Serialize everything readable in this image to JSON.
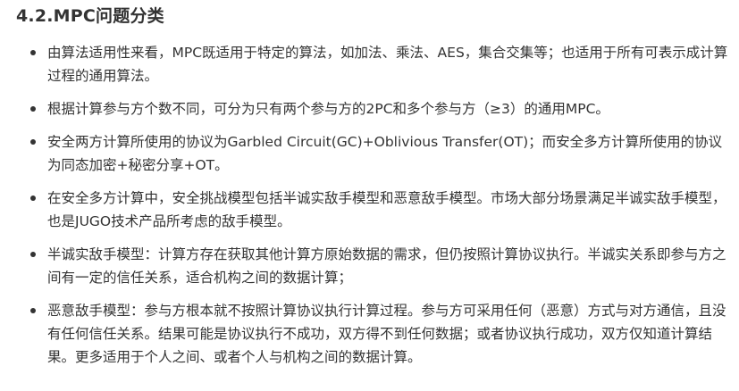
{
  "heading": "4.2.MPC问题分类",
  "items": [
    "由算法适用性来看，MPC既适用于特定的算法，如加法、乘法、AES，集合交集等；也适用于所有可表示成计算过程的通用算法。",
    "根据计算参与方个数不同，可分为只有两个参与方的2PC和多个参与方（≥3）的通用MPC。",
    "安全两方计算所使用的协议为Garbled Circuit(GC)+Oblivious Transfer(OT)；而安全多方计算所使用的协议为同态加密+秘密分享+OT。",
    "在安全多方计算中，安全挑战模型包括半诚实敌手模型和恶意敌手模型。市场大部分场景满足半诚实敌手模型，也是JUGO技术产品所考虑的敌手模型。",
    "半诚实敌手模型：计算方存在获取其他计算方原始数据的需求，但仍按照计算协议执行。半诚实关系即参与方之间有一定的信任关系，适合机构之间的数据计算；",
    "恶意敌手模型：参与方根本就不按照计算协议执行计算过程。参与方可采用任何（恶意）方式与对方通信，且没有任何信任关系。结果可能是协议执行不成功，双方得不到任何数据；或者协议执行成功，双方仅知道计算结果。更多适用于个人之间、或者个人与机构之间的数据计算。"
  ]
}
